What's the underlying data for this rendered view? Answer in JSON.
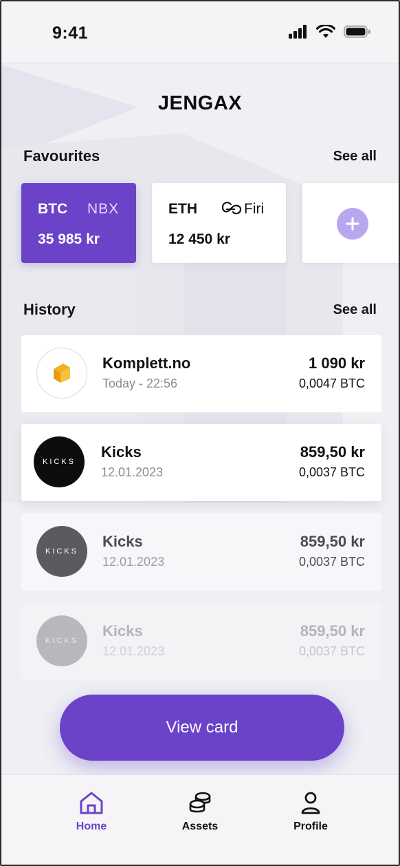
{
  "status_bar": {
    "time": "9:41"
  },
  "app": {
    "title": "JENGAX"
  },
  "favourites": {
    "title": "Favourites",
    "see_all": "See all",
    "cards": [
      {
        "symbol": "BTC",
        "exchange": "NBX",
        "amount": "35 985 kr"
      },
      {
        "symbol": "ETH",
        "exchange": "Firi",
        "amount": "12 450 kr"
      }
    ],
    "add_icon": "plus-icon"
  },
  "history": {
    "title": "History",
    "see_all": "See all",
    "items": [
      {
        "merchant": "Komplett.no",
        "date": "Today - 22:56",
        "amount": "1 090 kr",
        "crypto": "0,0047 BTC",
        "logo_text": ""
      },
      {
        "merchant": "Kicks",
        "date": "12.01.2023",
        "amount": "859,50 kr",
        "crypto": "0,0037 BTC",
        "logo_text": "KICKS"
      },
      {
        "merchant": "Kicks",
        "date": "12.01.2023",
        "amount": "859,50 kr",
        "crypto": "0,0037 BTC",
        "logo_text": "KICKS"
      },
      {
        "merchant": "Kicks",
        "date": "12.01.2023",
        "amount": "859,50 kr",
        "crypto": "0,0037 BTC",
        "logo_text": "KICKS"
      }
    ]
  },
  "actions": {
    "view_card": "View card"
  },
  "tab_bar": {
    "tabs": [
      {
        "label": "Home",
        "icon": "home-icon",
        "active": true
      },
      {
        "label": "Assets",
        "icon": "coins-icon",
        "active": false
      },
      {
        "label": "Profile",
        "icon": "profile-icon",
        "active": false
      }
    ]
  },
  "colors": {
    "accent": "#6A43C9",
    "accent_light": "#B8A7EF",
    "background": "#EEF0F4"
  }
}
